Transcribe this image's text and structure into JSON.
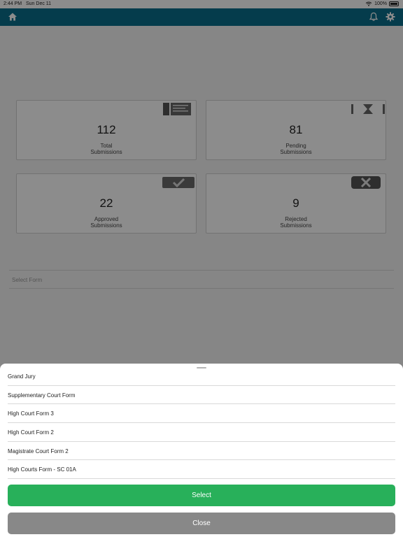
{
  "status_bar": {
    "time": "2:44 PM",
    "date": "Sun Dec 11",
    "battery": "100%"
  },
  "header": {
    "left_icon": "home-icon",
    "right_icons": [
      "bell-icon",
      "gear-icon"
    ],
    "color": "#0a6e8a"
  },
  "stats": {
    "total": {
      "value": "112",
      "label_line1": "Total",
      "label_line2": "Submissions",
      "icon": "document-stack-icon"
    },
    "pending": {
      "value": "81",
      "label_line1": "Pending",
      "label_line2": "Submissions",
      "icon": "hourglass-icon"
    },
    "approved": {
      "value": "22",
      "label_line1": "Approved",
      "label_line2": "Submissions",
      "icon": "checkmark-icon"
    },
    "rejected": {
      "value": "9",
      "label_line1": "Rejected",
      "label_line2": "Submissions",
      "icon": "x-mark-icon"
    }
  },
  "select_form": {
    "placeholder": "Select Form"
  },
  "sheet": {
    "options": [
      "Grand Jury",
      "Supplementary Court Form",
      "High Court Form 3",
      "High Court Form 2",
      "Magistrate Court Form 2",
      "High Courts Form - SC 01A"
    ],
    "select_label": "Select",
    "close_label": "Close",
    "select_color": "#28b05a",
    "close_color": "#888888"
  }
}
